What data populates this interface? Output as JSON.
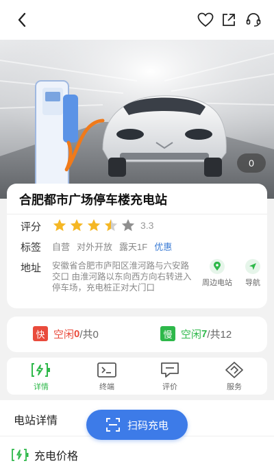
{
  "hero": {
    "photo_count": "0"
  },
  "station": {
    "name": "合肥都市广场停车楼充电站",
    "rating_label": "评分",
    "rating_value": 3.5,
    "rating_text": "3.3",
    "tags_label": "标签",
    "tags": [
      "自营",
      "对外开放",
      "露天1F"
    ],
    "promo_tag": "优惠",
    "address_label": "地址",
    "address": "安徽省合肥市庐阳区淮河路与六安路交口 由淮河路以东向西方向右转进入停车场，充电桩正对大门口",
    "nearby_label": "周边电站",
    "navigate_label": "导航"
  },
  "availability": {
    "fast_badge": "快",
    "fast_free": "空闲",
    "fast_free_count": "0",
    "fast_total": "/共0",
    "slow_badge": "慢",
    "slow_free": "空闲",
    "slow_free_count": "7",
    "slow_total": "/共12"
  },
  "tabs": [
    {
      "label": "详情",
      "icon": "charging-battery-icon"
    },
    {
      "label": "终端",
      "icon": "terminal-icon"
    },
    {
      "label": "评价",
      "icon": "comment-icon"
    },
    {
      "label": "服务",
      "icon": "service-icon"
    }
  ],
  "bottom": {
    "section_title": "电站详情",
    "price_title": "充电价格",
    "scan_button": "扫码充电"
  },
  "colors": {
    "green": "#2eb84a",
    "blue": "#3d7be8",
    "fast_red": "#e94b3c",
    "star": "#f5b724"
  }
}
